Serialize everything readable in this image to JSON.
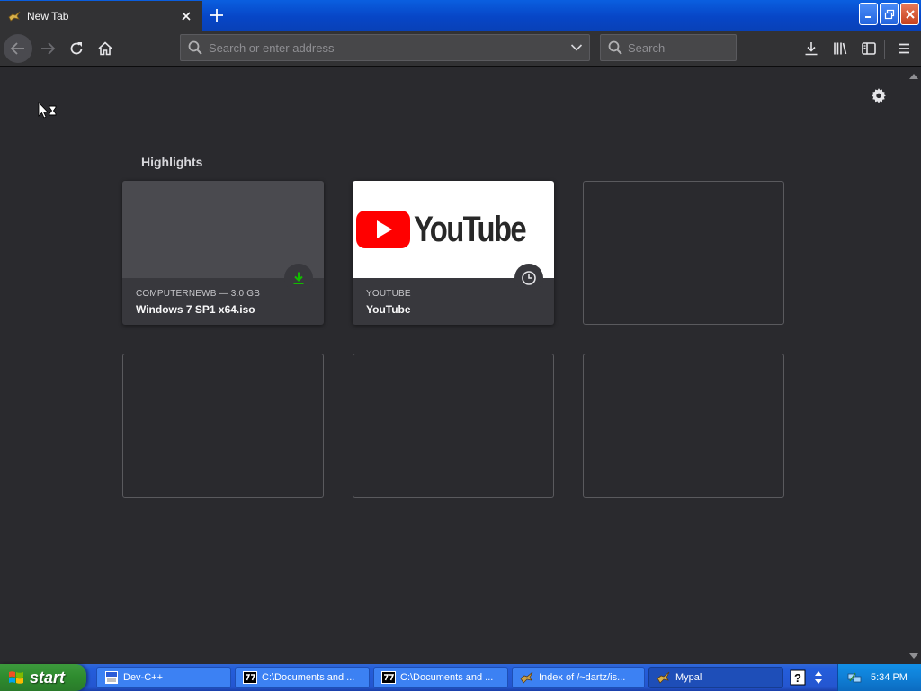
{
  "browser": {
    "tab": {
      "title": "New Tab"
    },
    "urlbar": {
      "placeholder": "Search or enter address"
    },
    "searchbar": {
      "placeholder": "Search"
    }
  },
  "newtab": {
    "section_title": "Highlights",
    "cards": [
      {
        "source": "COMPUTERNEWB — 3.0 GB",
        "title": "Windows 7 SP1 x64.iso",
        "badge": "download-icon"
      },
      {
        "source": "YOUTUBE",
        "title": "YouTube",
        "badge": "clock-icon",
        "logo_text": "YouTube"
      }
    ]
  },
  "taskbar": {
    "start_label": "start",
    "tasks": [
      {
        "label": "Dev-C++"
      },
      {
        "label": "C:\\Documents and ..."
      },
      {
        "label": "C:\\Documents and ..."
      },
      {
        "label": "Index of /~dartz/is..."
      },
      {
        "label": "Mypal"
      }
    ],
    "clock": "5:34 PM"
  },
  "colors": {
    "chrome": "#323234",
    "content_bg": "#2a2a2e",
    "download_green": "#12bc00",
    "youtube_red": "#ff0000",
    "xp_blue": "#245edb",
    "xp_green": "#2e8b2e"
  }
}
